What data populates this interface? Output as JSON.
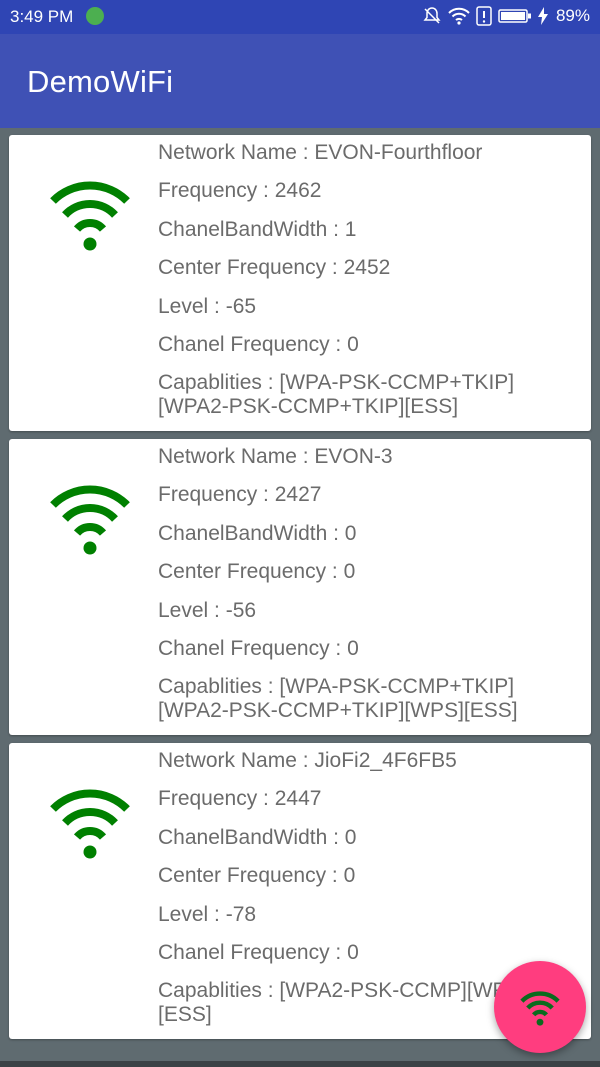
{
  "status_bar": {
    "time": "3:49 PM",
    "battery": "89%",
    "icons": [
      "android-notification-icon",
      "mute-bell-icon",
      "wifi-icon",
      "alert-icon",
      "battery-icon",
      "charging-bolt-icon"
    ]
  },
  "app_bar": {
    "title": "DemoWiFi"
  },
  "colors": {
    "primary": "#3f51b5",
    "primary_dark": "#2f45b4",
    "accent": "#ff3d7f",
    "wifi_icon": "#008000"
  },
  "networks": [
    {
      "name": "Network Name : EVON-Fourthfloor",
      "frequency": "Frequency : 2462",
      "bandwidth": "ChanelBandWidth : 1",
      "center": "Center Frequency : 2452",
      "level": "Level : -65",
      "chanel": "Chanel Frequency : 0",
      "capabilities": "Capablities : [WPA-PSK-CCMP+TKIP][WPA2-PSK-CCMP+TKIP][ESS]"
    },
    {
      "name": "Network Name : EVON-3",
      "frequency": "Frequency : 2427",
      "bandwidth": "ChanelBandWidth : 0",
      "center": "Center Frequency : 0",
      "level": "Level : -56",
      "chanel": "Chanel Frequency : 0",
      "capabilities": "Capablities : [WPA-PSK-CCMP+TKIP][WPA2-PSK-CCMP+TKIP][WPS][ESS]"
    },
    {
      "name": "Network Name : JioFi2_4F6FB5",
      "frequency": "Frequency : 2447",
      "bandwidth": "ChanelBandWidth : 0",
      "center": "Center Frequency : 0",
      "level": "Level : -78",
      "chanel": "Chanel Frequency : 0",
      "capabilities": "Capablities : [WPA2-PSK-CCMP][WPS][ESS]"
    }
  ],
  "fab": {
    "icon": "wifi-icon"
  }
}
